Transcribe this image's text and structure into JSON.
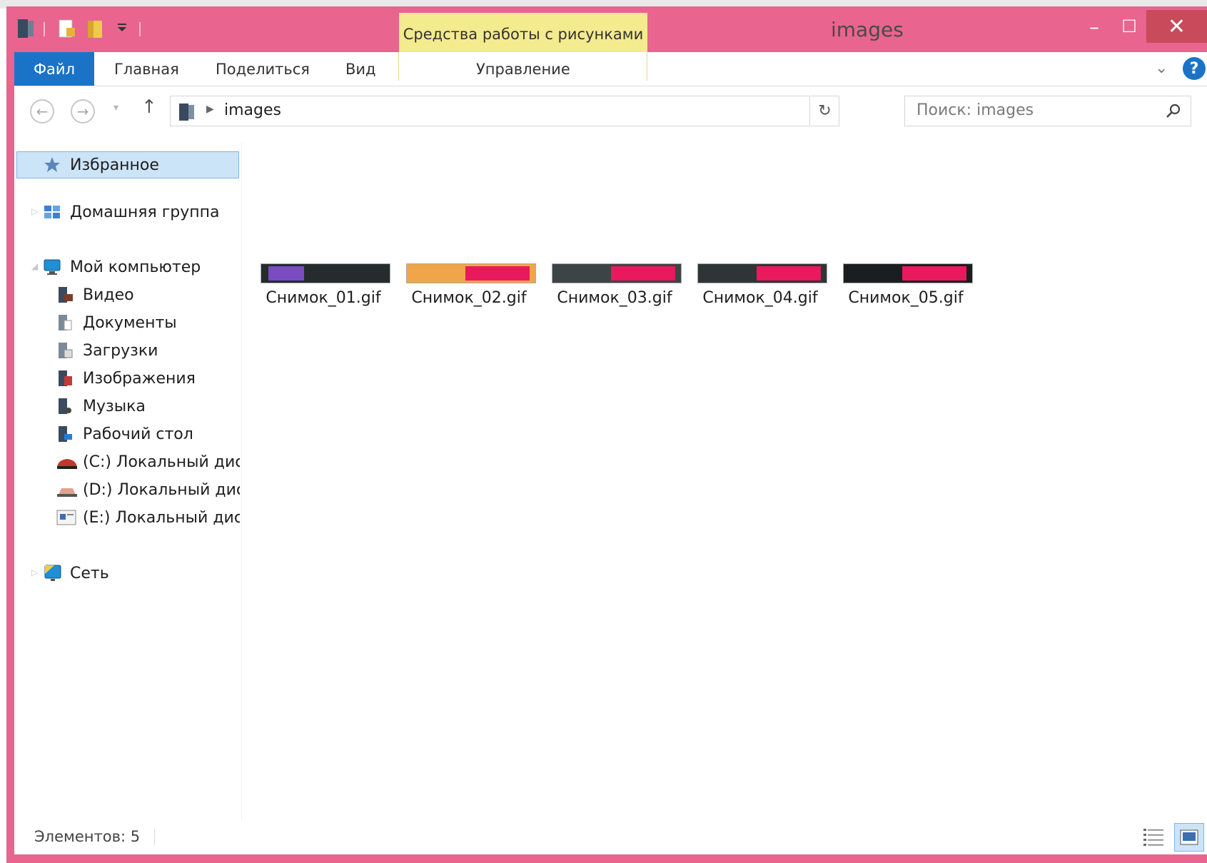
{
  "window": {
    "title": "images",
    "context_tab_label": "Средства работы с рисунками",
    "controls": {
      "minimize": "–",
      "maximize": "☐",
      "close": "✕"
    }
  },
  "ribbon": {
    "tabs": [
      {
        "label": "Файл"
      },
      {
        "label": "Главная"
      },
      {
        "label": "Поделиться"
      },
      {
        "label": "Вид"
      },
      {
        "label": "Управление"
      }
    ],
    "help_label": "?"
  },
  "navigation": {
    "back_label": "←",
    "forward_label": "→",
    "up_label": "↑",
    "address_path": "images",
    "refresh_label": "↻",
    "search_placeholder": "Поиск: images"
  },
  "sidebar": {
    "favorites": "Избранное",
    "homegroup": "Домашняя группа",
    "computer": "Мой компьютер",
    "computer_items": [
      {
        "label": "Видео"
      },
      {
        "label": "Документы"
      },
      {
        "label": "Загрузки"
      },
      {
        "label": "Изображения"
      },
      {
        "label": "Музыка"
      },
      {
        "label": "Рабочий стол"
      },
      {
        "label": "(C:) Локальный диск"
      },
      {
        "label": "(D:) Локальный диск"
      },
      {
        "label": "(E:) Локальный диск"
      }
    ],
    "network": "Сеть"
  },
  "files": [
    {
      "name": "Снимок_01.gif"
    },
    {
      "name": "Снимок_02.gif"
    },
    {
      "name": "Снимок_03.gif"
    },
    {
      "name": "Снимок_04.gif"
    },
    {
      "name": "Снимок_05.gif"
    }
  ],
  "status": {
    "item_count": "Элементов: 5"
  },
  "colors": {
    "window_frame": "#e9648f",
    "context_tab": "#f4ea8e",
    "file_tab": "#1b73c8",
    "selection": "#cce4f7",
    "thumb_accent": "#e8195d"
  }
}
